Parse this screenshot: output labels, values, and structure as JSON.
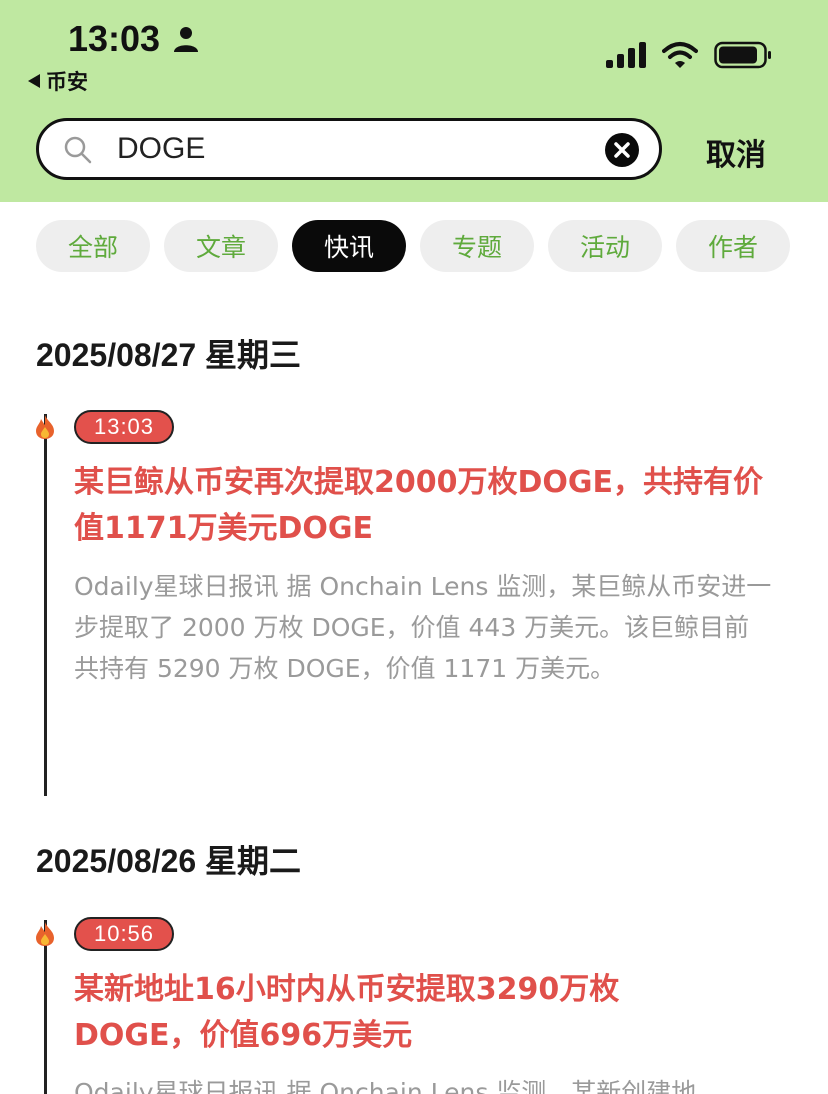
{
  "status_bar": {
    "time": "13:03",
    "back_label": "币安"
  },
  "search": {
    "query": "DOGE",
    "cancel_label": "取消"
  },
  "tabs": [
    {
      "label": "全部",
      "active": false
    },
    {
      "label": "文章",
      "active": false
    },
    {
      "label": "快讯",
      "active": true
    },
    {
      "label": "专题",
      "active": false
    },
    {
      "label": "活动",
      "active": false
    },
    {
      "label": "作者",
      "active": false
    }
  ],
  "feed": [
    {
      "date": "2025/08/27 星期三",
      "items": [
        {
          "time": "13:03",
          "title": "某巨鲸从币安再次提取2000万枚DOGE，共持有价值1171万美元DOGE",
          "body": "Odaily星球日报讯 据 Onchain Lens 监测，某巨鲸从币安进一步提取了 2000 万枚 DOGE，价值 443 万美元。该巨鲸目前共持有 5290 万枚 DOGE，价值 1171 万美元。"
        }
      ]
    },
    {
      "date": "2025/08/26 星期二",
      "items": [
        {
          "time": "10:56",
          "title": "某新地址16小时内从币安提取3290万枚DOGE，价值696万美元",
          "body": "Odaily星球日报讯 据 Onchain Lens 监测，某新创建地"
        }
      ]
    }
  ],
  "colors": {
    "header_bg": "#bfe8a1",
    "accent_red": "#e0504b",
    "tab_text": "#5faa3c"
  }
}
